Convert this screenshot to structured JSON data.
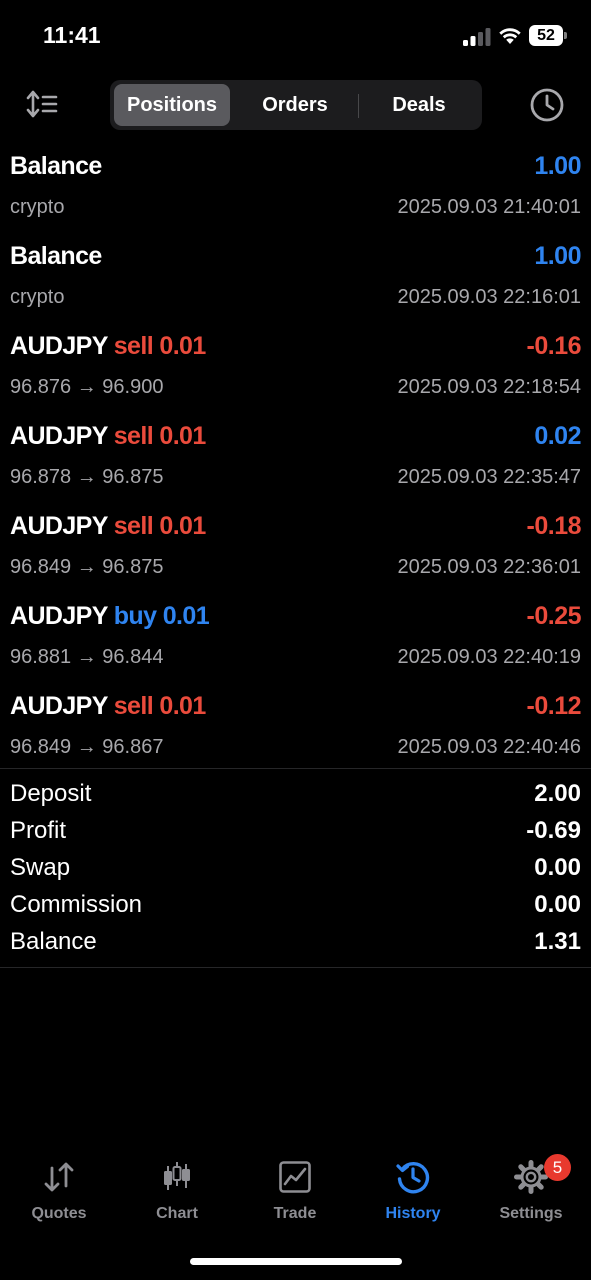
{
  "status_bar": {
    "time": "11:41",
    "battery_level": "52"
  },
  "header": {
    "tabs": [
      {
        "label": "Positions",
        "active": true
      },
      {
        "label": "Orders",
        "active": false
      },
      {
        "label": "Deals",
        "active": false
      }
    ]
  },
  "deals": [
    {
      "symbol": "Balance",
      "side": "",
      "volume": "",
      "sub": "crypto",
      "profit": "1.00",
      "time": "2025.09.03 21:40:01"
    },
    {
      "symbol": "Balance",
      "side": "",
      "volume": "",
      "sub": "crypto",
      "profit": "1.00",
      "time": "2025.09.03 22:16:01"
    },
    {
      "symbol": "AUDJPY",
      "side": "sell",
      "volume": "0.01",
      "sub": "96.876 → 96.900",
      "profit": "-0.16",
      "time": "2025.09.03 22:18:54"
    },
    {
      "symbol": "AUDJPY",
      "side": "sell",
      "volume": "0.01",
      "sub": "96.878 → 96.875",
      "profit": "0.02",
      "time": "2025.09.03 22:35:47"
    },
    {
      "symbol": "AUDJPY",
      "side": "sell",
      "volume": "0.01",
      "sub": "96.849 → 96.875",
      "profit": "-0.18",
      "time": "2025.09.03 22:36:01"
    },
    {
      "symbol": "AUDJPY",
      "side": "buy",
      "volume": "0.01",
      "sub": "96.881 → 96.844",
      "profit": "-0.25",
      "time": "2025.09.03 22:40:19"
    },
    {
      "symbol": "AUDJPY",
      "side": "sell",
      "volume": "0.01",
      "sub": "96.849 → 96.867",
      "profit": "-0.12",
      "time": "2025.09.03 22:40:46"
    }
  ],
  "summary": [
    {
      "label": "Deposit",
      "value": "2.00"
    },
    {
      "label": "Profit",
      "value": "-0.69"
    },
    {
      "label": "Swap",
      "value": "0.00"
    },
    {
      "label": "Commission",
      "value": "0.00"
    },
    {
      "label": "Balance",
      "value": "1.31"
    }
  ],
  "tabbar": {
    "items": [
      {
        "label": "Quotes",
        "icon": "quotes-arrows-icon",
        "active": false
      },
      {
        "label": "Chart",
        "icon": "candlestick-icon",
        "active": false
      },
      {
        "label": "Trade",
        "icon": "trade-chart-icon",
        "active": false
      },
      {
        "label": "History",
        "icon": "history-clock-icon",
        "active": true
      },
      {
        "label": "Settings",
        "icon": "gear-icon",
        "active": false
      }
    ],
    "settings_badge": "5"
  },
  "colors": {
    "accent_blue": "#2f84f0",
    "loss_red": "#ea4b3c",
    "background": "#000000"
  }
}
